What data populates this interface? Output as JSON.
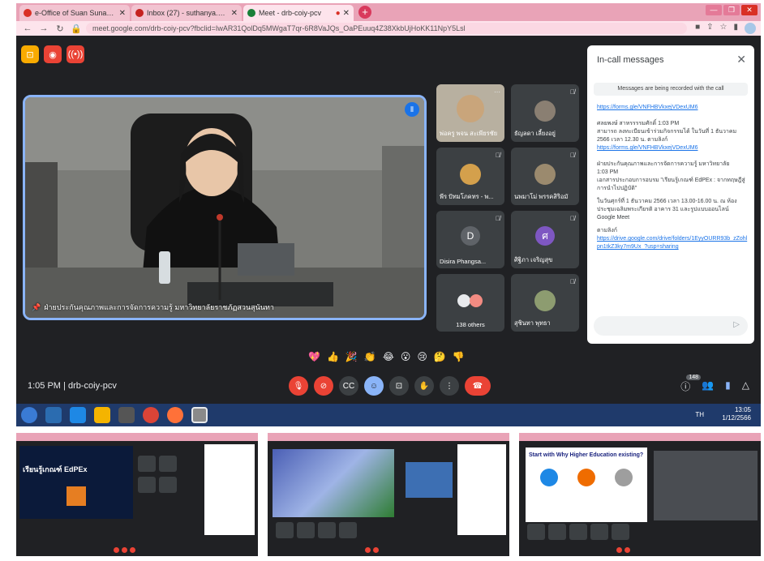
{
  "browser": {
    "tabs": [
      {
        "label": "e-Office of Suan Sunandha Rajab",
        "color": "#d93025",
        "active": false
      },
      {
        "label": "Inbox (27) - suthanya.pu@ssru.a",
        "color": "#c5221f",
        "active": false
      },
      {
        "label": "Meet - drb-coiy-pcv",
        "color": "#188038",
        "active": true
      }
    ],
    "new_tab": "+",
    "url": "meet.google.com/drb-coiy-pcv?fbclid=IwAR31QolDq5MWgaT7qr-6R8VaJQs_OaPEuuq4Z38XkbUjHoKK11NpY5Lsl"
  },
  "meet": {
    "main_speaker_name": "ฝ่ายประกันคุณภาพและการจัดการความรู้ มหาวิทยาลัยราชภัฏสวนสุนันทา",
    "meeting_time": "1:05 PM",
    "meeting_code": "drb-coiy-pcv",
    "participant_count": "148",
    "participants": [
      {
        "name": "พ่อครู พจน สะเพียรชัย",
        "type": "video",
        "color": "#c9a57b"
      },
      {
        "name": "ธัญลดา เลี้ยงอยู่",
        "type": "photo",
        "color": "#8a7f72"
      },
      {
        "name": "พีร ปัทมโภคทร - พ...",
        "type": "photo",
        "color": "#d4a04c"
      },
      {
        "name": "นพมาโม่ พรรคสิริอมั",
        "type": "photo",
        "color": "#9b8a6e"
      },
      {
        "name": "Disira Phangsa...",
        "type": "initial",
        "initial": "D",
        "color": "#5f6368"
      },
      {
        "name": "ศิฐิภา เจริญสุข",
        "type": "initial",
        "initial": "ศ",
        "color": "#7e57c2"
      },
      {
        "name": "138 others",
        "type": "others"
      },
      {
        "name": "สุชินทา พุทธา",
        "type": "photo",
        "color": "#8d9c70"
      }
    ],
    "reactions": [
      "💖",
      "👍",
      "🎉",
      "👏",
      "😂",
      "😮",
      "😢",
      "🤔",
      "👎"
    ]
  },
  "chat": {
    "title": "In-call messages",
    "recording_note": "Messages are being recorded with the call",
    "link1": "https://forms.gle/VNFHBVkxejVDexUM6",
    "msg2_sender": "ศลยพงษ์ สาหรรรรมศักดิ์",
    "msg2_time": "1:03 PM",
    "msg2_text": "สามารถ ลงทะเบียนเข้าร่วมกิจกรรมได้ ในวันที่ 1 ธันวาคม 2566 เวลา 12.30 น. ตามลิงก์",
    "msg2_link": "https://forms.gle/VNFHBVkxejVDexUM6",
    "msg3_sender": "ฝ่ายประกันคุณภาพและการจัดการความรู้ มหาวิทยาลัย",
    "msg3_time": "1:03 PM",
    "msg3_text1": "เอกสารประกอบการอบรม \"เรียนรู้เกณฑ์ EdPEx : จากทฤษฎีสู่การนำไปปฏิบัติ\"",
    "msg3_text2": "ในวันศุกร์ที่ 1 ธันวาคม 2566 เวลา 13.00-16.00 น. ณ ห้องประชุมเฉลิมพระเกียรติ อาคาร 31 และรูปแบบออนไลน์ Google Meet",
    "msg3_text3": "ตามลิงก์",
    "msg3_link": "https://drive.google.com/drive/folders/1EyyOURR93b_zZohlpn1tkZ3ky7m9Ux_?usp=sharing"
  },
  "taskbar": {
    "lang": "TH",
    "time": "13:05",
    "date": "1/12/2566"
  },
  "thumbnails": {
    "slide_title": "เรียนรู้เกณฑ์ EdPEx",
    "slide2_title": "Start with Why Higher Education existing?"
  }
}
